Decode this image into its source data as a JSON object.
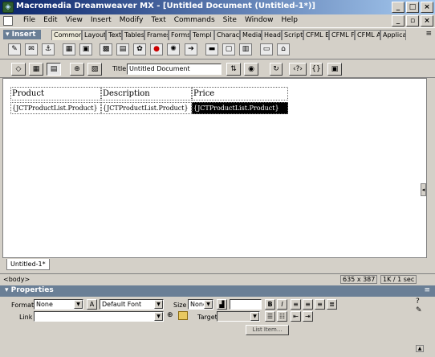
{
  "window": {
    "title": "Macromedia Dreamweaver MX - [Untitled Document (Untitled-1*)]",
    "app_icon": "dreamweaver-logo-icon"
  },
  "menubar": {
    "items": [
      "File",
      "Edit",
      "View",
      "Insert",
      "Modify",
      "Text",
      "Commands",
      "Site",
      "Window",
      "Help"
    ]
  },
  "insert_panel": {
    "label": "Insert",
    "tabs": [
      "Common",
      "Layout",
      "Text",
      "Tables",
      "Frames",
      "Forms",
      "Templ",
      "Charact",
      "Media",
      "Head",
      "Script",
      "CFML B",
      "CFML F",
      "CFML A",
      "Applica"
    ],
    "active_tab": "Common"
  },
  "doc_toolbar": {
    "title_label": "Title:",
    "title_value": "Untitled Document"
  },
  "document": {
    "headers": [
      "Product",
      "Description",
      "Price"
    ],
    "row": [
      "{JCTProductList.Product}",
      "{JCTProductList.Product}",
      "{JCTProductList.Product}"
    ],
    "tab_label": "Untitled-1*"
  },
  "status": {
    "tag": "<body>",
    "size": "635 x 387",
    "download": "1K / 1 sec"
  },
  "properties": {
    "label": "Properties",
    "format_label": "Format",
    "format_value": "None",
    "font_value": "Default Font",
    "size_label": "Size",
    "size_value": "None",
    "link_label": "Link",
    "target_label": "Target",
    "list_item_label": "List Item..."
  }
}
